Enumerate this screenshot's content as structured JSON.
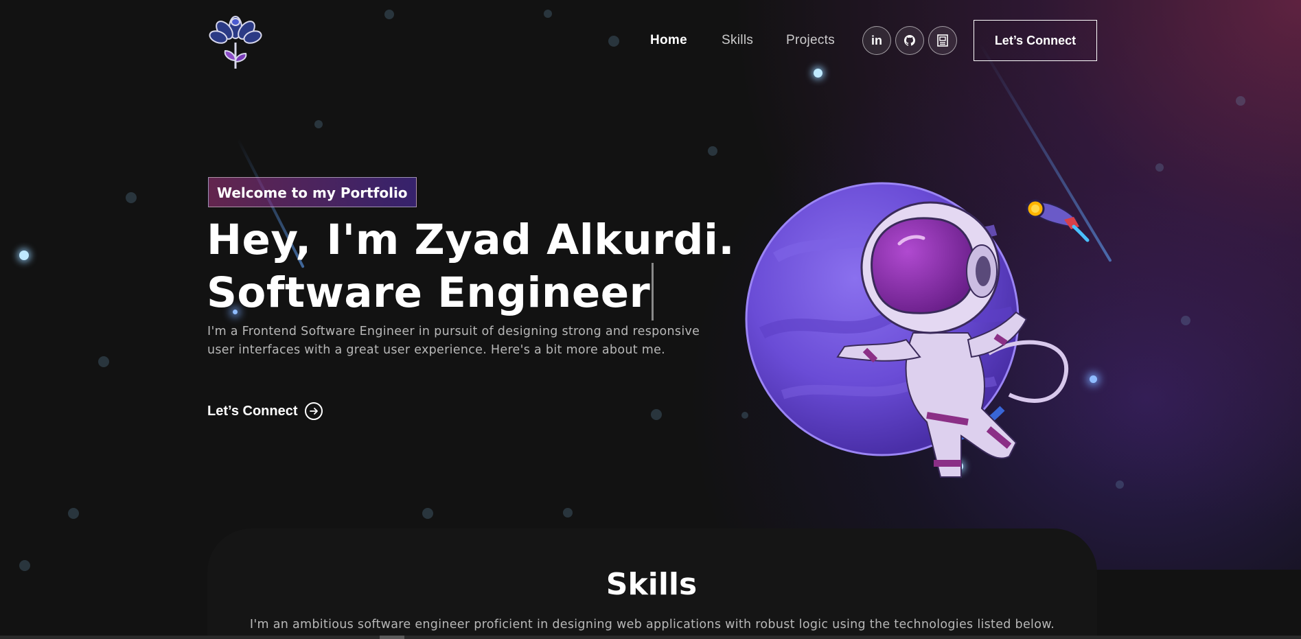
{
  "nav": {
    "links": [
      {
        "label": "Home",
        "active": true
      },
      {
        "label": "Skills",
        "active": false
      },
      {
        "label": "Projects",
        "active": false
      }
    ],
    "social_icons": [
      "linkedin-icon",
      "github-icon",
      "resume-icon"
    ],
    "social_labels": [
      "in"
    ],
    "cta_label": "Let’s Connect"
  },
  "hero": {
    "tagline": "Welcome to my Portfolio",
    "title_line1": "Hey, I'm Zyad Alkurdi.",
    "title_line2": "Software Engineer",
    "description": "I'm a Frontend Software Engineer in pursuit of designing strong and responsive user interfaces with a great user experience. Here's a bit more about me.",
    "connect_label": "Let’s Connect"
  },
  "skills": {
    "title": "Skills",
    "description": "I'm an ambitious software engineer proficient in designing web applications with robust logic using the technologies listed below."
  },
  "colors": {
    "background": "#121212",
    "accent_pink": "#aa367c",
    "accent_purple": "#4a2fbd",
    "planet": "#6b4fd8"
  }
}
